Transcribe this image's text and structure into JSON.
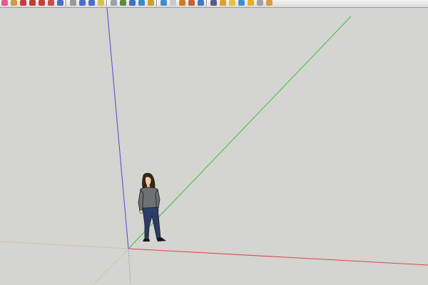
{
  "toolbar": {
    "tools": [
      {
        "name": "eraser-tool-icon",
        "color": "#e85a8a"
      },
      {
        "name": "paint-bucket-icon",
        "color": "#c8a03c"
      },
      {
        "name": "push-pull-icon",
        "color": "#c83c3c"
      },
      {
        "name": "follow-me-icon",
        "color": "#b84030"
      },
      {
        "name": "rotate-icon",
        "color": "#c83c3c"
      },
      {
        "name": "scale-icon",
        "color": "#d04848"
      },
      {
        "name": "orbit-icon",
        "color": "#4a6fc8"
      },
      {
        "name": "pan-icon",
        "color": "#9a9a9a"
      },
      {
        "name": "zoom-icon",
        "color": "#4a6fc8"
      },
      {
        "name": "zoom-extents-icon",
        "color": "#4a6fc8"
      },
      {
        "name": "tape-measure-icon",
        "color": "#d6c040"
      },
      {
        "name": "text-tool-icon",
        "color": "#9aa0a8"
      },
      {
        "name": "section-plane-icon",
        "color": "#5a8a3c"
      },
      {
        "name": "walk-icon",
        "color": "#3c6fc8"
      },
      {
        "name": "look-around-icon",
        "color": "#3c8ac8"
      },
      {
        "name": "components-icon",
        "color": "#d0a030"
      },
      {
        "name": "materials-icon",
        "color": "#4a8ac8"
      },
      {
        "name": "styles-icon",
        "color": "#c8c8c8"
      },
      {
        "name": "google-earth-icon",
        "color": "#d07a20"
      },
      {
        "name": "get-models-icon",
        "color": "#c86030"
      },
      {
        "name": "share-model-icon",
        "color": "#3c7ac8"
      },
      {
        "name": "extension-warehouse-icon",
        "color": "#5a5a8a"
      },
      {
        "name": "add-location-icon",
        "color": "#e0a020"
      },
      {
        "name": "toggle-terrain-icon",
        "color": "#e8c040"
      },
      {
        "name": "preview-in-earth-icon",
        "color": "#3c90c8"
      },
      {
        "name": "sun-shadows-icon",
        "color": "#e8b020"
      },
      {
        "name": "fog-icon",
        "color": "#a0a0a0"
      },
      {
        "name": "dynamic-components-icon",
        "color": "#d0a040"
      }
    ]
  },
  "scene": {
    "axis_colors": {
      "blue_axis": "#4b4bd6",
      "green_axis": "#3fbf3f",
      "red_axis": "#d44848"
    },
    "background": "#d4d4d0",
    "person_figure": "person-scale-figure"
  }
}
